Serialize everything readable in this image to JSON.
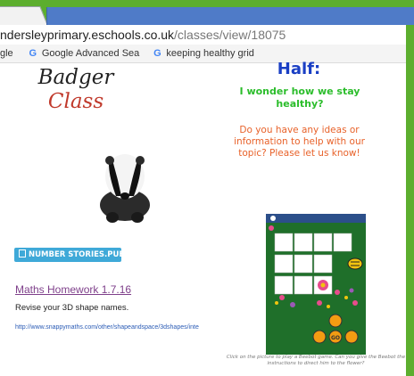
{
  "browser": {
    "url_domain": "ndersleyprimary.eschools.co.uk",
    "url_path": "/classes/view/18075",
    "bookmarks": [
      {
        "label": "gle"
      },
      {
        "label": "Google Advanced Sea"
      },
      {
        "label": "keeping healthy grid"
      }
    ]
  },
  "page": {
    "class_name_line1": "Badger",
    "class_name_line2": "Class",
    "half_heading": "Half:",
    "wonder_text": "I wonder how we stay healthy?",
    "ideas_text": "Do you have any ideas or information to help with our topic?  Please let us know!",
    "pub_button_label": "NUMBER STORIES.PUB",
    "maths_link": "Maths Homework 1.7.16",
    "revise_text": "Revise your 3D shape names.",
    "shape_url": "http://www.snappymaths.com/other/shapeandspace/3dshapes/inte",
    "beebot_caption": "Click on the picture to play a Beebot game. Can you give the Beebot the instructions to direct him to the flower?",
    "beebot_button_go": "GO"
  },
  "colors": {
    "frame_green": "#5cae2e",
    "title_blue": "#1a3fc4",
    "wonder_green": "#2bbd2b",
    "ideas_orange": "#e8622a",
    "button_blue": "#3fa9d8",
    "link_purple": "#7e3f8a"
  }
}
